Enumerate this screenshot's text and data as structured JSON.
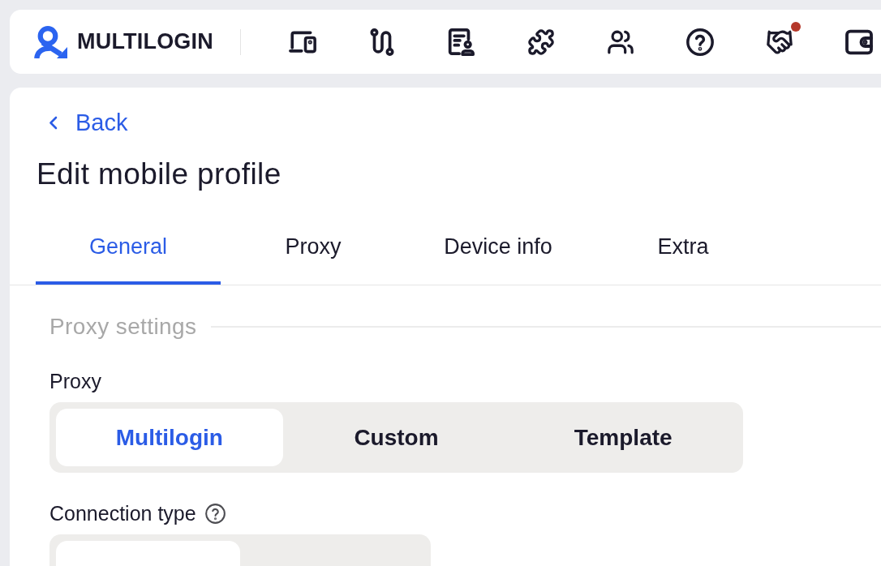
{
  "header": {
    "logo_text": "MULTILOGIN",
    "notification": true
  },
  "back_link": "Back",
  "title": "Edit mobile profile",
  "tabs": [
    {
      "label": "General",
      "selected": true
    },
    {
      "label": "Proxy",
      "selected": false
    },
    {
      "label": "Device info",
      "selected": false
    },
    {
      "label": "Extra",
      "selected": false
    }
  ],
  "section": {
    "title": "Proxy settings",
    "fields": [
      {
        "label": "Proxy",
        "help": false,
        "options": [
          {
            "label": "Multilogin",
            "selected": true
          },
          {
            "label": "Custom",
            "selected": false
          },
          {
            "label": "Template",
            "selected": false
          }
        ]
      },
      {
        "label": "Connection type",
        "help": true,
        "options": [
          {
            "selected": true
          },
          {
            "selected": false
          }
        ]
      }
    ]
  }
}
